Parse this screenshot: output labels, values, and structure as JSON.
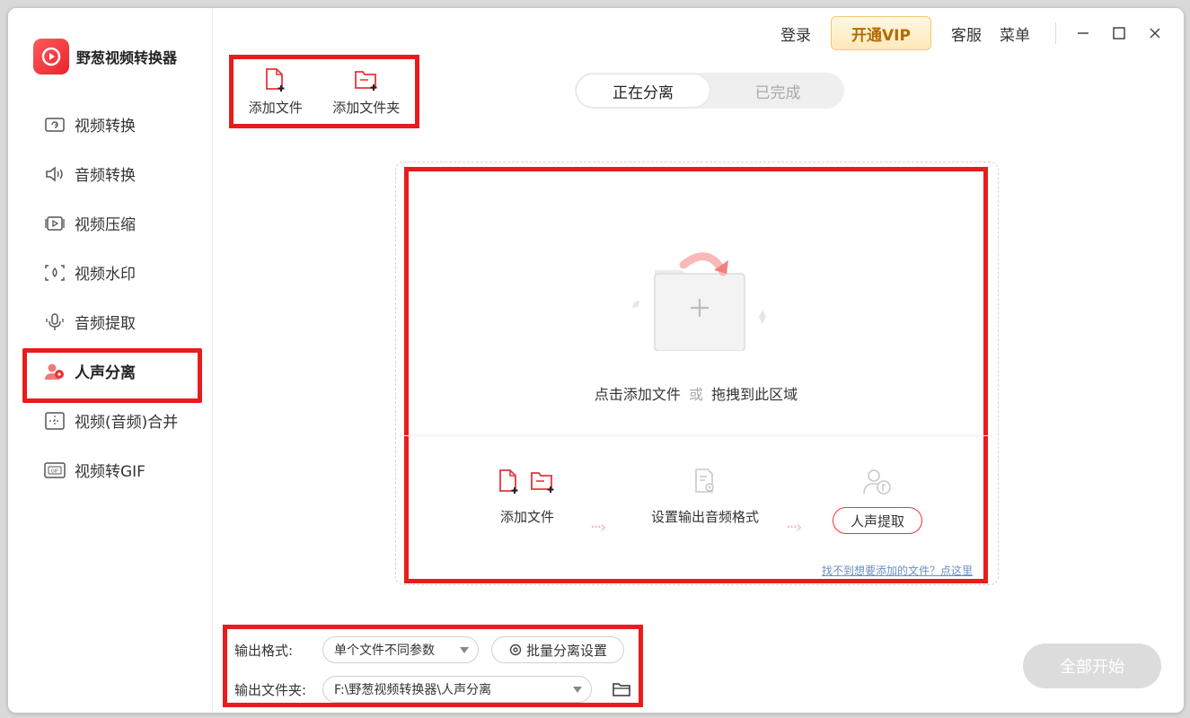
{
  "app": {
    "name": "野葱视频转换器",
    "brand_color": "#e8242c"
  },
  "topbar": {
    "login": "登录",
    "vip": "开通VIP",
    "support": "客服",
    "menu": "菜单"
  },
  "sidebar": {
    "items": [
      {
        "label": "视频转换",
        "icon": "video-convert-icon"
      },
      {
        "label": "音频转换",
        "icon": "audio-convert-icon"
      },
      {
        "label": "视频压缩",
        "icon": "video-compress-icon"
      },
      {
        "label": "视频水印",
        "icon": "watermark-icon"
      },
      {
        "label": "音频提取",
        "icon": "audio-extract-icon"
      },
      {
        "label": "人声分离",
        "icon": "vocal-separate-icon",
        "active": true
      },
      {
        "label": "视频(音频)合并",
        "icon": "merge-icon"
      },
      {
        "label": "视频转GIF",
        "icon": "gif-icon"
      }
    ]
  },
  "toolbar": {
    "add_file": "添加文件",
    "add_folder": "添加文件夹"
  },
  "tabs": {
    "active": "正在分离",
    "done": "已完成"
  },
  "dropzone": {
    "hint_click": "点击添加文件",
    "hint_or": "或",
    "hint_drag": "拖拽到此区域",
    "steps": {
      "step1": "添加文件",
      "step2": "设置输出音频格式",
      "step3": "人声提取"
    },
    "help_link": "找不到想要添加的文件？点这里"
  },
  "output": {
    "format_label": "输出格式:",
    "format_value": "单个文件不同参数",
    "batch_settings": "批量分离设置",
    "folder_label": "输出文件夹:",
    "folder_value": "F:\\野葱视频转换器\\人声分离"
  },
  "actions": {
    "start_all": "全部开始"
  }
}
